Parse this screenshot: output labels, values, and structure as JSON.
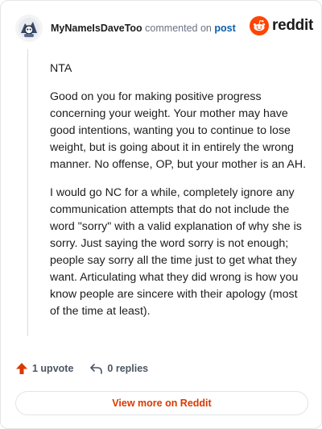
{
  "header": {
    "username": "MyNameIsDaveToo",
    "action_text": " commented on ",
    "post_link": "post",
    "brand": "reddit"
  },
  "comment": {
    "paragraphs": [
      "NTA",
      "Good on you for making positive progress concerning your weight. Your mother may have good intentions, wanting you to continue to lose weight, but is going about it in entirely the wrong manner. No offense, OP, but your mother is an AH.",
      "I would go NC for a while, completely ignore any communication attempts that do not include the word \"sorry\" with a valid explanation of why she is sorry. Just saying the word sorry is not enough; people say sorry all the time just to get what they want. Articulating what they did wrong is how you know people are sincere with their apology (most of the time at least)."
    ]
  },
  "actions": {
    "upvotes": "1 upvote",
    "replies": "0 replies"
  },
  "footer": {
    "view_more": "View more on Reddit"
  },
  "colors": {
    "accent": "#d93a00",
    "reddit_orange": "#ff4500",
    "link_blue": "#0b5ea8"
  },
  "icons": {
    "avatar": "user-avatar",
    "brand": "reddit-logo-icon",
    "upvote": "upvote-arrow-icon",
    "reply": "reply-arrow-icon"
  }
}
